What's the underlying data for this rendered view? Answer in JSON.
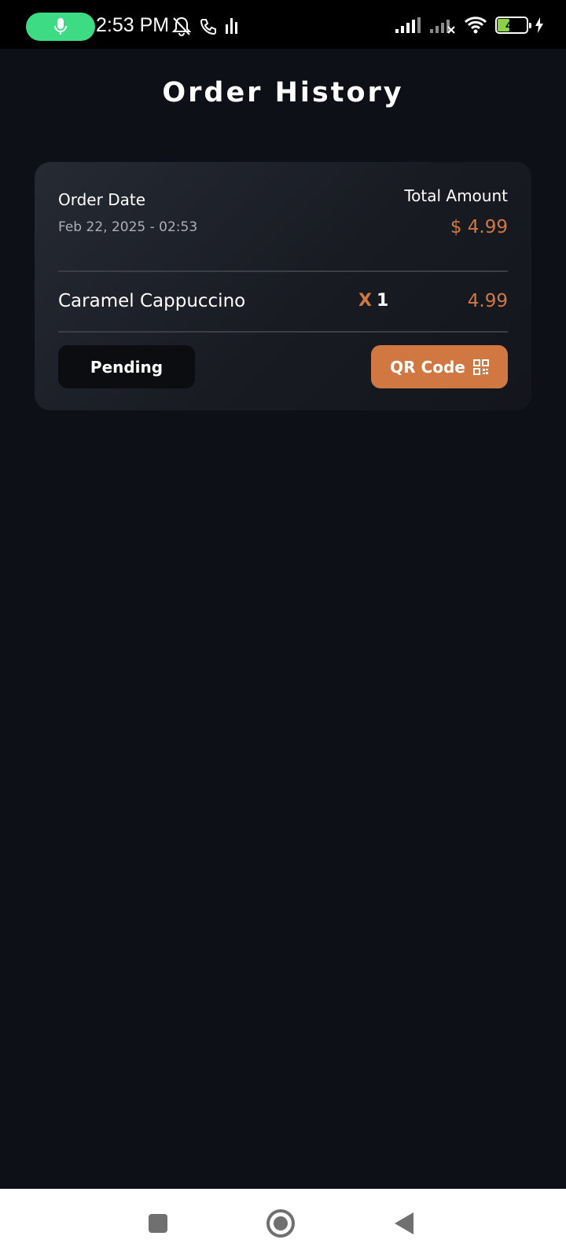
{
  "status_bar": {
    "time": "2:53 PM",
    "battery": "40",
    "battery_level": 0.4,
    "icons": [
      "microphone-icon",
      "notifications-off-icon",
      "call-icon",
      "activity-icon",
      "signal-icon",
      "signal-no-service-icon",
      "wifi-icon",
      "battery-icon",
      "charging-icon"
    ]
  },
  "page": {
    "title": "Order History"
  },
  "order": {
    "date_label": "Order Date",
    "date_value": "Feb 22, 2025 - 02:53",
    "total_label": "Total Amount",
    "total_value": "$ 4.99",
    "item": {
      "name": "Caramel Cappuccino",
      "qty_prefix": "X",
      "qty": "1",
      "price": "4.99"
    },
    "status_label": "Pending",
    "qr_label": "QR Code"
  },
  "colors": {
    "accent": "#d17842",
    "background": "#0d1016",
    "card": "#1c1f26",
    "mic_pill": "#3ddc84"
  },
  "nav_bar": {
    "icons": [
      "recents-icon",
      "home-icon",
      "back-icon"
    ]
  }
}
